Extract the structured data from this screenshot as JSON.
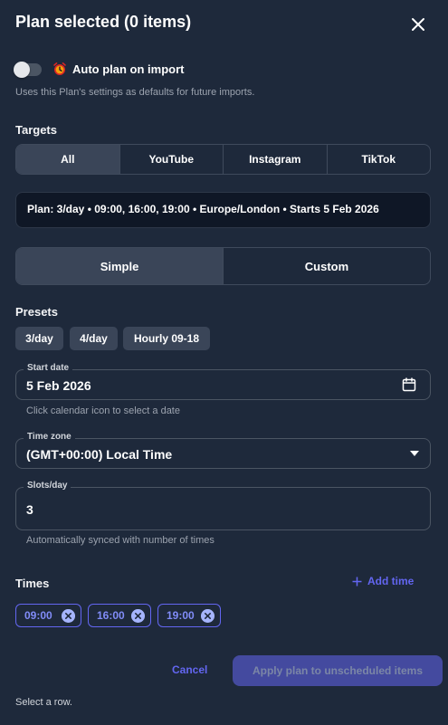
{
  "header": {
    "title": "Plan selected (0 items)"
  },
  "auto_plan": {
    "label": "Auto plan on import",
    "enabled": false,
    "help": "Uses this Plan's settings as defaults for future imports."
  },
  "targets": {
    "label": "Targets",
    "options": [
      "All",
      "YouTube",
      "Instagram",
      "TikTok"
    ],
    "selected": "All"
  },
  "plan_summary": "Plan: 3/day • 09:00, 16:00, 19:00 • Europe/London • Starts 5 Feb 2026",
  "mode": {
    "options": [
      "Simple",
      "Custom"
    ],
    "selected": "Simple"
  },
  "presets": {
    "label": "Presets",
    "items": [
      "3/day",
      "4/day",
      "Hourly 09-18"
    ]
  },
  "start_date": {
    "label": "Start date",
    "value": "5 Feb 2026",
    "helper": "Click calendar icon to select a date"
  },
  "time_zone": {
    "label": "Time zone",
    "value": "(GMT+00:00) Local Time"
  },
  "slots": {
    "label": "Slots/day",
    "value": "3",
    "helper": "Automatically synced with number of times"
  },
  "times": {
    "label": "Times",
    "add_label": "Add time",
    "items": [
      "09:00",
      "16:00",
      "19:00"
    ]
  },
  "footer": {
    "cancel": "Cancel",
    "apply": "Apply plan to unscheduled items",
    "status": "Select a row."
  },
  "colors": {
    "accent": "#6366f1",
    "panel": "#1e293b",
    "active_segment": "#3a4558"
  }
}
